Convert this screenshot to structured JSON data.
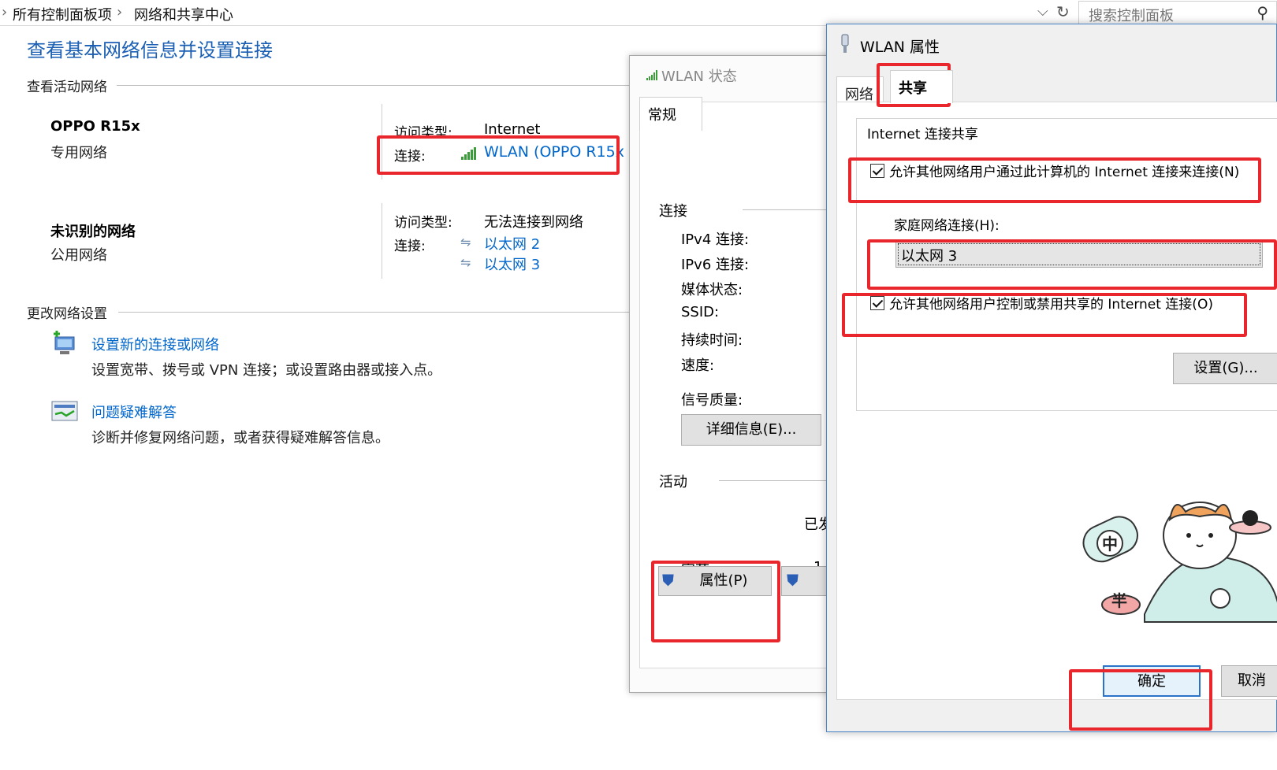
{
  "address_bar": {
    "crumb1": "所有控制面板项",
    "sep": "›",
    "crumb2": "网络和共享中心",
    "search_placeholder": "搜索控制面板"
  },
  "main": {
    "title": "查看基本网络信息并设置连接",
    "active_networks_heading": "查看活动网络",
    "networks": [
      {
        "name": "OPPO R15x",
        "type": "专用网络",
        "access_label": "访问类型:",
        "access_value": "Internet",
        "conn_label": "连接:",
        "conn_values": [
          "WLAN (OPPO R15x"
        ]
      },
      {
        "name": "未识别的网络",
        "type": "公用网络",
        "access_label": "访问类型:",
        "access_value": "无法连接到网络",
        "conn_label": "连接:",
        "conn_values": [
          "以太网 2",
          "以太网 3"
        ]
      }
    ],
    "change_settings_heading": "更改网络设置",
    "tasks": [
      {
        "title": "设置新的连接或网络",
        "desc": "设置宽带、拨号或 VPN 连接；或设置路由器或接入点。"
      },
      {
        "title": "问题疑难解答",
        "desc": "诊断并修复网络问题，或者获得疑难解答信息。"
      }
    ]
  },
  "status_dialog": {
    "title": "WLAN 状态",
    "tab": "常规",
    "connection_heading": "连接",
    "fields": [
      "IPv4 连接:",
      "IPv6 连接:",
      "媒体状态:",
      "SSID:",
      "持续时间:",
      "速度:"
    ],
    "signal_label": "信号质量:",
    "details_button": "详细信息(E)...",
    "activity_heading": "活动",
    "sent_partial": "已发",
    "bytes_label": "字节:",
    "bytes_partial": "1",
    "properties_button": "属性(P)"
  },
  "properties_dialog": {
    "title": "WLAN 属性",
    "tabs": [
      "网络",
      "共享"
    ],
    "group_heading": "Internet 连接共享",
    "allow_share": "允许其他网络用户通过此计算机的 Internet 连接来连接(N)",
    "home_label": "家庭网络连接(H):",
    "home_value": "以太网 3",
    "allow_control": "允许其他网络用户控制或禁用共享的 Internet 连接(O)",
    "settings_button": "设置(G)...",
    "ok_button": "确定",
    "cancel_button": "取消",
    "mascot_badges": [
      "中",
      "半"
    ]
  }
}
